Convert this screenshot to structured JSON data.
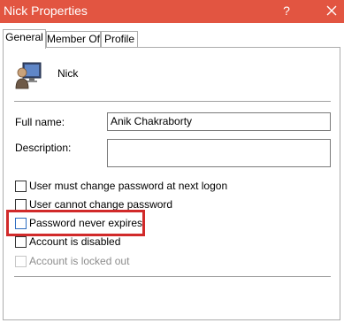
{
  "window": {
    "title": "Nick Properties",
    "help_label": "?",
    "title_bar_color": "#e25541"
  },
  "tabs": [
    {
      "label": "General",
      "active": true
    },
    {
      "label": "Member Of",
      "active": false
    },
    {
      "label": "Profile",
      "active": false
    }
  ],
  "user": {
    "name": "Nick",
    "icon": "user-icon"
  },
  "form": {
    "full_name_label": "Full name:",
    "full_name_value": "Anik Chakraborty",
    "description_label": "Description:",
    "description_value": ""
  },
  "options": [
    {
      "label": "User must change password at next logon",
      "checked": false,
      "enabled": true
    },
    {
      "label": "User cannot change password",
      "checked": false,
      "enabled": true
    },
    {
      "label": "Password never expires",
      "checked": false,
      "enabled": true,
      "highlighted": true
    },
    {
      "label": "Account is disabled",
      "checked": false,
      "enabled": true
    },
    {
      "label": "Account is locked out",
      "checked": false,
      "enabled": false
    }
  ],
  "highlight_color": "#d12a2a"
}
